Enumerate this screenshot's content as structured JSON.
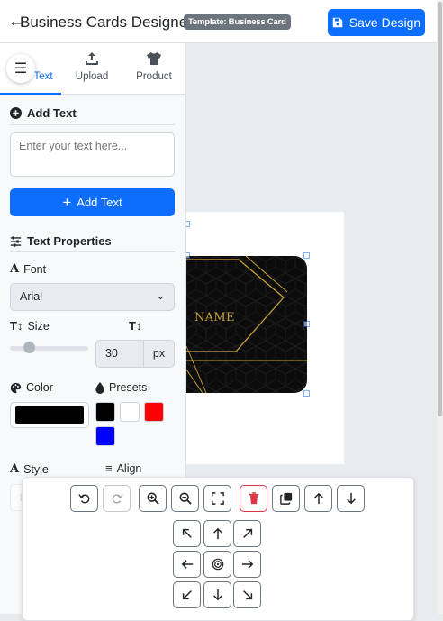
{
  "header": {
    "back_icon": "arrow-left-icon",
    "title": "Business Cards Designer",
    "template_badge": "Template: Business Card",
    "save_label": "Save Design",
    "save_icon": "floppy-disk-icon"
  },
  "colors": {
    "primary": "#0d6efd",
    "danger": "#dc3545",
    "card_background": "#0c0c0c",
    "card_gold": "#c9a13b"
  },
  "sidebar": {
    "tabs": [
      {
        "label": "Text",
        "icon": "text-icon",
        "active": true
      },
      {
        "label": "Upload",
        "icon": "upload-icon",
        "active": false
      },
      {
        "label": "Product",
        "icon": "tshirt-icon",
        "active": false
      }
    ],
    "menu_icon": "hamburger-menu-icon",
    "add_text": {
      "heading": "Add Text",
      "placeholder": "Enter your text here...",
      "button_label": "Add Text"
    },
    "text_properties": {
      "heading": "Text Properties",
      "font_label": "Font",
      "font_value": "Arial",
      "size_label": "Size",
      "size_value": "30",
      "size_unit": "px",
      "color_label": "Color",
      "color_value": "#000000",
      "presets_label": "Presets",
      "presets": [
        "#000000",
        "#ffffff",
        "#ff0000",
        "#0000ff"
      ],
      "style_label": "Style",
      "align_label": "Align"
    }
  },
  "card": {
    "name_text": "NAME"
  },
  "tools": {
    "top_row": [
      "undo-icon",
      "redo-icon",
      "zoom-in-icon",
      "zoom-out-icon",
      "fit-screen-icon",
      "delete-icon",
      "duplicate-icon",
      "bring-forward-icon",
      "send-backward-icon"
    ],
    "nudge_grid": [
      "arrow-up-left-icon",
      "arrow-up-icon",
      "arrow-up-right-icon",
      "arrow-left-icon",
      "center-target-icon",
      "arrow-right-icon",
      "arrow-down-left-icon",
      "arrow-down-icon",
      "arrow-down-right-icon"
    ]
  }
}
